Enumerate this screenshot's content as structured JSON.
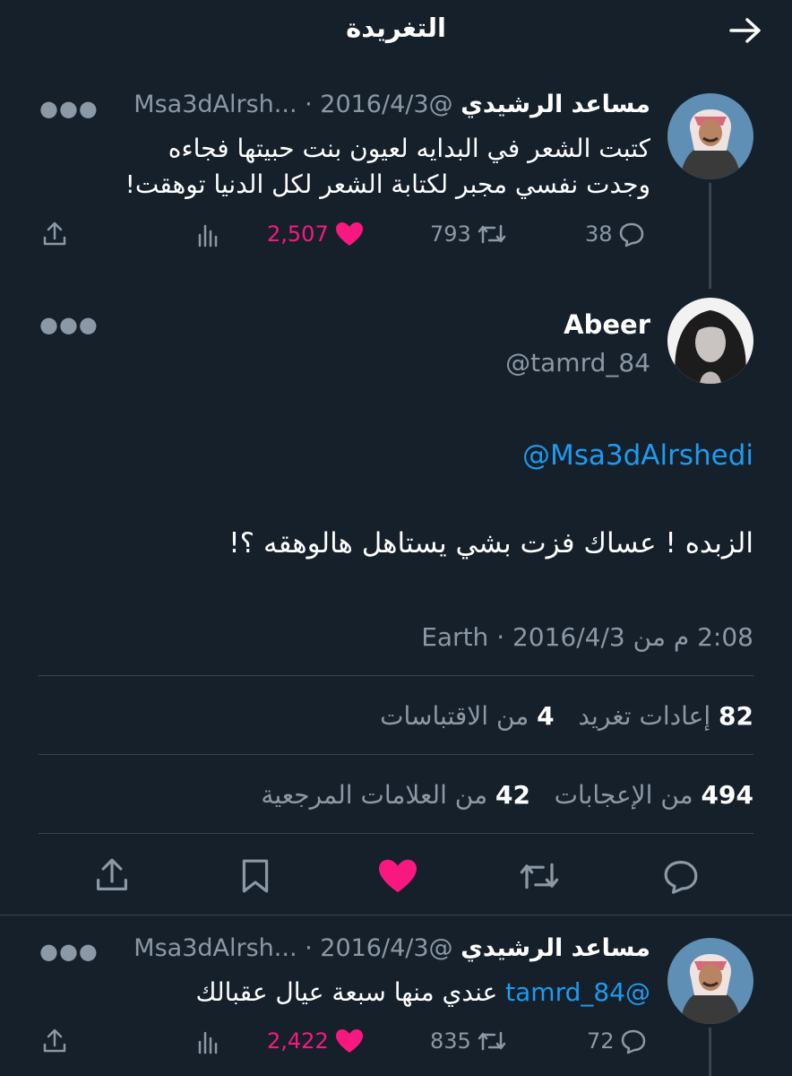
{
  "header": {
    "title": "التغريدة"
  },
  "tweet1": {
    "name": "مساعد الرشيدي",
    "meta": "@Msa3dAlrsh... · 2016/4/3",
    "text_line1": "كتبت الشعر في البدايه  لعيون  بنت حبيتها  فجاءه",
    "text_line2": "وجدت نفسي مجبر لكتابة الشعر لكل الدنيا توهقت!",
    "replies": "38",
    "retweets": "793",
    "likes": "2,507"
  },
  "main": {
    "name": "Abeer",
    "handle": "@tamrd_84",
    "mention": "@Msa3dAlrshedi",
    "text": "الزبده ! عساك فزت بشي يستاهل هالوهقه  ؟!",
    "time": "2:08 م من Earth · 2016/4/3",
    "retweets_count": "82",
    "retweets_label": "إعادات تغريد",
    "quotes_count": "4",
    "quotes_label": "من الاقتباسات",
    "likes_count": "494",
    "likes_label": "من الإعجابات",
    "bookmarks_count": "42",
    "bookmarks_label": "من العلامات المرجعية"
  },
  "tweet3": {
    "name": "مساعد الرشيدي",
    "meta": "@Msa3dAlrsh... · 2016/4/3",
    "mention": "@tamrd_84",
    "text": " عندي منها سبعة عيال عقبالك",
    "replies": "72",
    "retweets": "835",
    "likes": "2,422"
  },
  "colors": {
    "background": "#15202b",
    "accent": "#1d9bf0",
    "like": "#f91880",
    "muted": "#8b98a5"
  },
  "icons": [
    "back-arrow-icon",
    "more-icon",
    "reply-icon",
    "retweet-icon",
    "heart-icon",
    "views-icon",
    "share-icon",
    "bookmark-icon"
  ]
}
